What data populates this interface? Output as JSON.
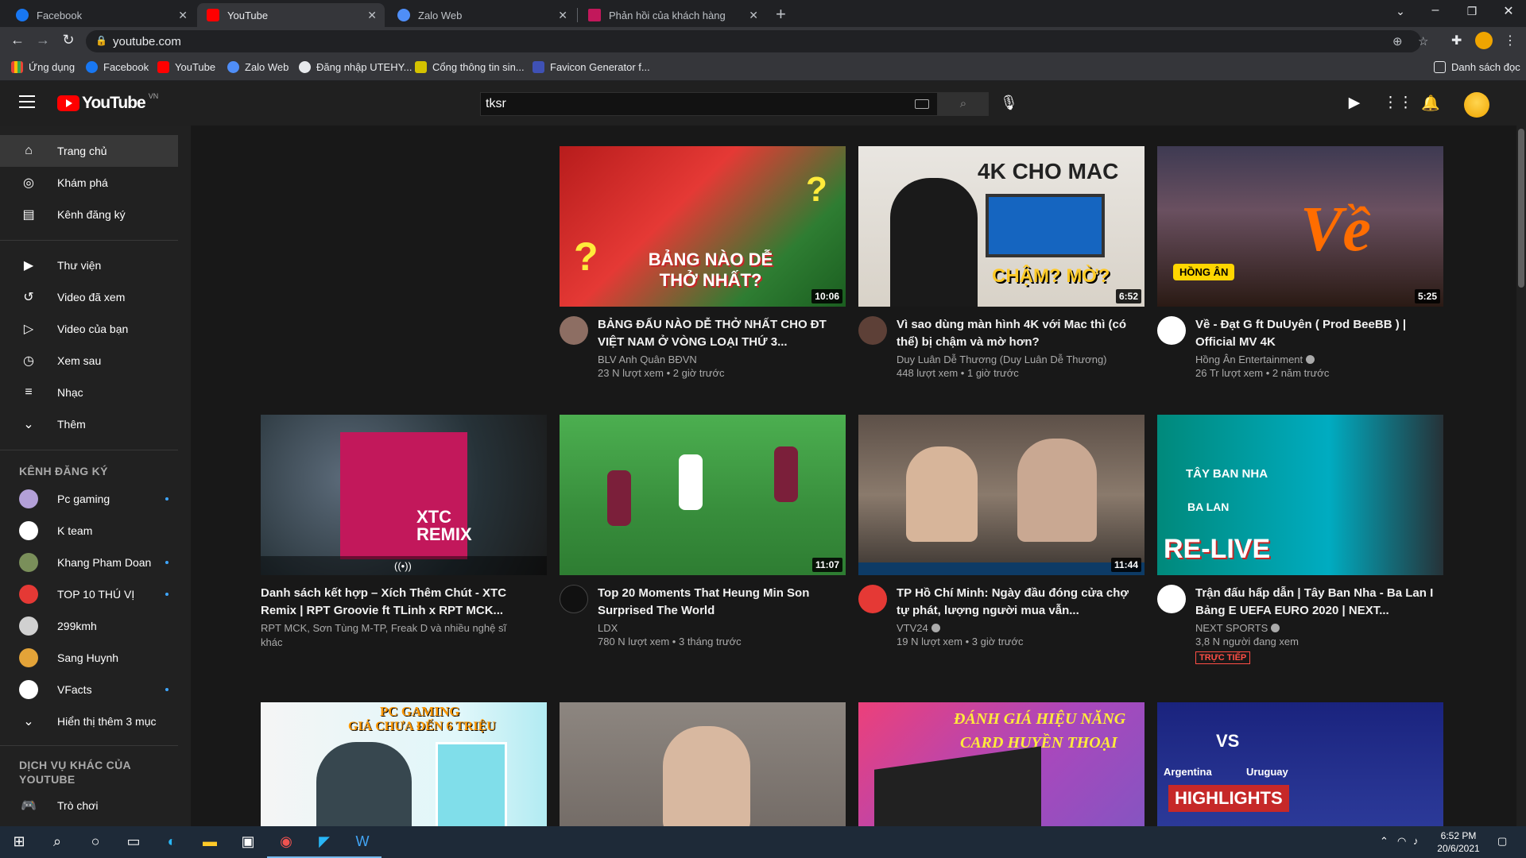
{
  "browser": {
    "tabs": [
      {
        "label": "Facebook"
      },
      {
        "label": "YouTube"
      },
      {
        "label": "Zalo Web"
      },
      {
        "label": "Phản hồi của khách hàng"
      }
    ],
    "url": "youtube.com",
    "bookmarks": [
      {
        "label": "Ứng dụng"
      },
      {
        "label": "Facebook"
      },
      {
        "label": "YouTube"
      },
      {
        "label": "Zalo Web"
      },
      {
        "label": "Đăng nhập UTEHY..."
      },
      {
        "label": "Cổng thông tin sin..."
      },
      {
        "label": "Favicon Generator f..."
      }
    ],
    "reading_list": "Danh sách đọc"
  },
  "youtube": {
    "logo_text": "YouTube",
    "logo_country": "VN",
    "search_value": "tksr"
  },
  "sidebar": {
    "main": [
      {
        "label": "Trang chủ",
        "icon": "home-icon"
      },
      {
        "label": "Khám phá",
        "icon": "compass-icon"
      },
      {
        "label": "Kênh đăng ký",
        "icon": "subscriptions-icon"
      }
    ],
    "library": [
      {
        "label": "Thư viện",
        "icon": "library-icon"
      },
      {
        "label": "Video đã xem",
        "icon": "history-icon"
      },
      {
        "label": "Video của bạn",
        "icon": "your-videos-icon"
      },
      {
        "label": "Xem sau",
        "icon": "clock-icon"
      },
      {
        "label": "Nhạc",
        "icon": "playlist-icon"
      },
      {
        "label": "Thêm",
        "icon": "chevron-down-icon"
      }
    ],
    "subs_heading": "KÊNH ĐĂNG KÝ",
    "subs": [
      {
        "label": "Pc gaming",
        "color": "#b3a0d8",
        "new": true
      },
      {
        "label": "K team",
        "color": "#ffffff",
        "new": false
      },
      {
        "label": "Khang Pham Doan",
        "color": "#7a8f5a",
        "new": true
      },
      {
        "label": "TOP 10 THÚ VỊ",
        "color": "#e53935",
        "new": true
      },
      {
        "label": "299kmh",
        "color": "#d0d0d0",
        "new": false
      },
      {
        "label": "Sang Huynh",
        "color": "#e3a338",
        "new": false
      },
      {
        "label": "VFacts",
        "color": "#ffffff",
        "new": true
      }
    ],
    "show_more": "Hiển thị thêm 3 mục",
    "more_heading": "DỊCH VỤ KHÁC CỦA YOUTUBE",
    "gaming": "Trò chơi"
  },
  "videos": [
    {
      "title": "BẢNG ĐẤU NÀO DỄ THỞ NHẤT CHO ĐT VIỆT NAM Ở VÒNG LOẠI THỨ 3...",
      "channel": "BLV Anh Quân BĐVN",
      "meta": "23 N lượt xem • 2 giờ trước",
      "duration": "10:06",
      "thumb_text": "BẢNG NÀO DỄ THỞ NHẤT?"
    },
    {
      "title": "Vì sao dùng màn hình 4K với Mac thì (có thể) bị chậm và mờ hơn?",
      "channel": "Duy Luân Dễ Thương (Duy Luân Dễ Thương)",
      "meta": "448 lượt xem • 1 giờ trước",
      "duration": "6:52",
      "thumb_text": "4K CHO MAC",
      "thumb_text2": "CHẬM? MỜ?"
    },
    {
      "title": "Về - Đạt G ft DuUyên ( Prod BeeBB ) | Official MV 4K",
      "channel": "Hồng Ân Entertainment",
      "meta": "26 Tr lượt xem • 2 năm trước",
      "duration": "5:25",
      "thumb_text": "Về",
      "thumb_text2": "HỒNG ÂN"
    },
    {
      "title": "Danh sách kết hợp – Xích Thêm Chút - XTC Remix | RPT Groovie ft TLinh x RPT MCK...",
      "channel": "RPT MCK, Sơn Tùng M-TP, Freak D và nhiều nghệ sĩ khác",
      "meta": "",
      "duration": "",
      "thumb_text": "XTC REMIX"
    },
    {
      "title": "Top 20 Moments That Heung Min Son Surprised The World",
      "channel": "LDX",
      "meta": "780 N lượt xem • 3 tháng trước",
      "duration": "11:07",
      "thumb_text": ""
    },
    {
      "title": "TP Hồ Chí Minh: Ngày đầu đóng cửa chợ tự phát, lượng người mua vẫn...",
      "channel": "VTV24",
      "meta": "19 N lượt xem • 3 giờ trước",
      "duration": "11:44",
      "thumb_text": ""
    },
    {
      "title": "Trận đấu hấp dẫn | Tây Ban Nha - Ba Lan I Bảng E UEFA EURO 2020 | NEXT...",
      "channel": "NEXT SPORTS",
      "meta": "3,8 N người đang xem",
      "duration": "",
      "thumb_text": "TÂY BAN NHA",
      "thumb_text2": "BA LAN",
      "thumb_text3": "RE-LIVE",
      "live": "TRỰC TIẾP"
    },
    {
      "title": "",
      "channel": "",
      "meta": "",
      "duration": "",
      "thumb_text": "PC GAMING",
      "thumb_text2": "GIÁ CHƯA ĐẾN 6 TRIỆU"
    },
    {
      "title": "",
      "channel": "",
      "meta": "",
      "duration": "",
      "thumb_text": ""
    },
    {
      "title": "",
      "channel": "",
      "meta": "",
      "duration": "",
      "thumb_text": "ĐÁNH GIÁ HIỆU NĂNG",
      "thumb_text2": "CARD HUYỀN THOẠI"
    },
    {
      "title": "",
      "channel": "",
      "meta": "",
      "duration": "",
      "thumb_text": "HIGHLIGHTS",
      "thumb_text2": "Argentina",
      "thumb_text3": "Uruguay",
      "thumb_text4": "VS"
    }
  ],
  "taskbar": {
    "time": "6:52 PM",
    "date": "20/6/2021"
  }
}
